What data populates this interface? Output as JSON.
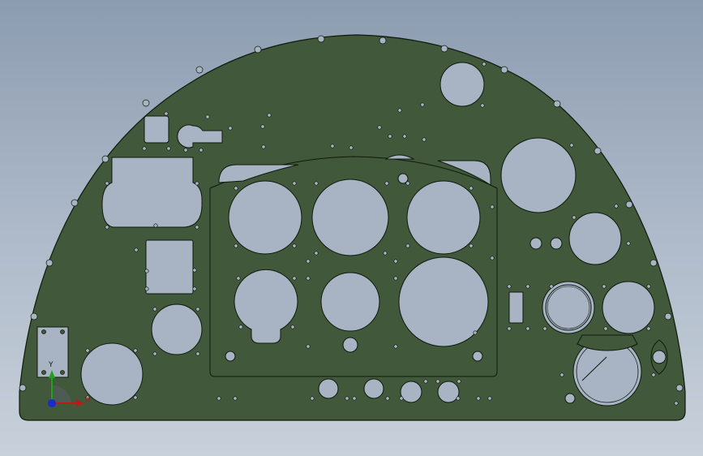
{
  "colors": {
    "background_top": "#8c9cb0",
    "background_bottom": "#c8d0da",
    "panel_fill": "#41583a",
    "panel_stroke": "#0f1a0d",
    "hole_fill": "#a8b3c4",
    "axis_y": "#1fa31f",
    "axis_x": "#c01818",
    "axis_z": "#1a2ad0"
  },
  "triad": {
    "y_label": "Y",
    "x_label": "X"
  },
  "icons": [
    "coordinate-triad-icon"
  ]
}
